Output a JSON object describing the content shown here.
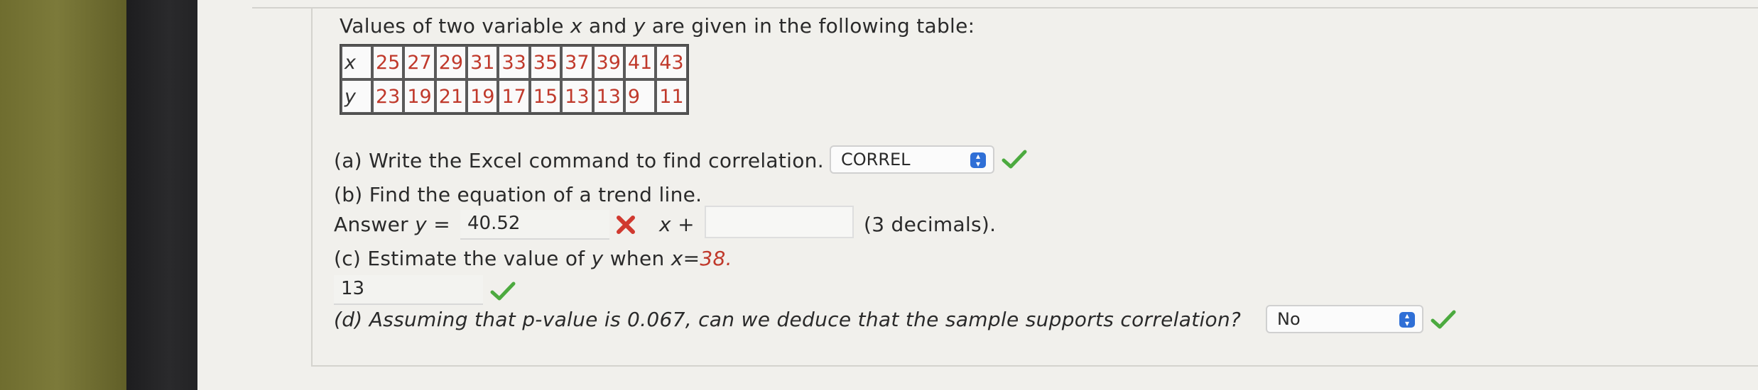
{
  "question": {
    "intro_a": "Values of two variable",
    "intro_var_x": "x",
    "intro_and": "and",
    "intro_var_y": "y",
    "intro_b": "are given in the following table:"
  },
  "table": {
    "x_label": "x",
    "y_label": "y",
    "x_values": [
      "25",
      "27",
      "29",
      "31",
      "33",
      "35",
      "37",
      "39",
      "41",
      "43"
    ],
    "y_values": [
      "23",
      "19",
      "21",
      "19",
      "17",
      "15",
      "13",
      "13",
      "9",
      "11"
    ]
  },
  "part_a": {
    "label": "(a) Write the Excel command to find correlation.",
    "selected": "CORREL",
    "status": "correct"
  },
  "part_b": {
    "label": "(b) Find the equation of a trend line.",
    "answer_prefix": "Answer",
    "answer_var": "y",
    "equals": "=",
    "slope_value": "40.52",
    "slope_status": "incorrect",
    "x_plus": "+",
    "x_var": "x",
    "intercept_value": "",
    "suffix": "(3 decimals)."
  },
  "part_c": {
    "label_a": "(c) Estimate the value of",
    "label_var": "y",
    "label_b": "when",
    "label_x": "x",
    "label_eq": "=",
    "x_value": "38.",
    "answer": "13",
    "status": "correct"
  },
  "part_d": {
    "label": "(d) Assuming that p-value is 0.067, can we deduce that the sample supports correlation?",
    "selected": "No",
    "status": "correct"
  },
  "colors": {
    "accent_blue": "#2f6fd6",
    "check_green": "#4caa3f",
    "cross_red": "#d0392f",
    "table_red": "#c0392b"
  }
}
